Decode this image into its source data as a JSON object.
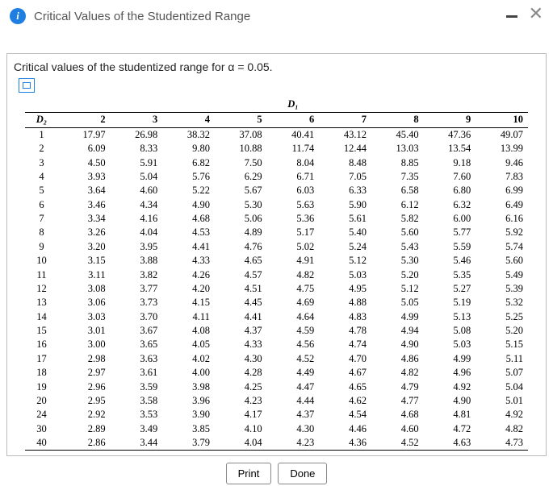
{
  "header": {
    "title": "Critical Values of the Studentized Range",
    "info_icon": "i"
  },
  "panel": {
    "caption": "Critical values of the studentized range for α = 0.05."
  },
  "chart_data": {
    "type": "table",
    "title": "Critical values of the studentized range for α = 0.05",
    "col_super_label": "D₁",
    "row_label": "D₂",
    "columns": [
      "2",
      "3",
      "4",
      "5",
      "6",
      "7",
      "8",
      "9",
      "10"
    ],
    "rows": [
      {
        "d2": "1",
        "v": [
          "17.97",
          "26.98",
          "38.32",
          "37.08",
          "40.41",
          "43.12",
          "45.40",
          "47.36",
          "49.07"
        ]
      },
      {
        "d2": "2",
        "v": [
          "6.09",
          "8.33",
          "9.80",
          "10.88",
          "11.74",
          "12.44",
          "13.03",
          "13.54",
          "13.99"
        ]
      },
      {
        "d2": "3",
        "v": [
          "4.50",
          "5.91",
          "6.82",
          "7.50",
          "8.04",
          "8.48",
          "8.85",
          "9.18",
          "9.46"
        ]
      },
      {
        "d2": "4",
        "v": [
          "3.93",
          "5.04",
          "5.76",
          "6.29",
          "6.71",
          "7.05",
          "7.35",
          "7.60",
          "7.83"
        ]
      },
      {
        "d2": "5",
        "v": [
          "3.64",
          "4.60",
          "5.22",
          "5.67",
          "6.03",
          "6.33",
          "6.58",
          "6.80",
          "6.99"
        ]
      },
      {
        "d2": "6",
        "v": [
          "3.46",
          "4.34",
          "4.90",
          "5.30",
          "5.63",
          "5.90",
          "6.12",
          "6.32",
          "6.49"
        ]
      },
      {
        "d2": "7",
        "v": [
          "3.34",
          "4.16",
          "4.68",
          "5.06",
          "5.36",
          "5.61",
          "5.82",
          "6.00",
          "6.16"
        ]
      },
      {
        "d2": "8",
        "v": [
          "3.26",
          "4.04",
          "4.53",
          "4.89",
          "5.17",
          "5.40",
          "5.60",
          "5.77",
          "5.92"
        ]
      },
      {
        "d2": "9",
        "v": [
          "3.20",
          "3.95",
          "4.41",
          "4.76",
          "5.02",
          "5.24",
          "5.43",
          "5.59",
          "5.74"
        ]
      },
      {
        "d2": "10",
        "v": [
          "3.15",
          "3.88",
          "4.33",
          "4.65",
          "4.91",
          "5.12",
          "5.30",
          "5.46",
          "5.60"
        ]
      },
      {
        "d2": "11",
        "v": [
          "3.11",
          "3.82",
          "4.26",
          "4.57",
          "4.82",
          "5.03",
          "5.20",
          "5.35",
          "5.49"
        ]
      },
      {
        "d2": "12",
        "v": [
          "3.08",
          "3.77",
          "4.20",
          "4.51",
          "4.75",
          "4.95",
          "5.12",
          "5.27",
          "5.39"
        ]
      },
      {
        "d2": "13",
        "v": [
          "3.06",
          "3.73",
          "4.15",
          "4.45",
          "4.69",
          "4.88",
          "5.05",
          "5.19",
          "5.32"
        ]
      },
      {
        "d2": "14",
        "v": [
          "3.03",
          "3.70",
          "4.11",
          "4.41",
          "4.64",
          "4.83",
          "4.99",
          "5.13",
          "5.25"
        ]
      },
      {
        "d2": "15",
        "v": [
          "3.01",
          "3.67",
          "4.08",
          "4.37",
          "4.59",
          "4.78",
          "4.94",
          "5.08",
          "5.20"
        ]
      },
      {
        "d2": "16",
        "v": [
          "3.00",
          "3.65",
          "4.05",
          "4.33",
          "4.56",
          "4.74",
          "4.90",
          "5.03",
          "5.15"
        ]
      },
      {
        "d2": "17",
        "v": [
          "2.98",
          "3.63",
          "4.02",
          "4.30",
          "4.52",
          "4.70",
          "4.86",
          "4.99",
          "5.11"
        ]
      },
      {
        "d2": "18",
        "v": [
          "2.97",
          "3.61",
          "4.00",
          "4.28",
          "4.49",
          "4.67",
          "4.82",
          "4.96",
          "5.07"
        ]
      },
      {
        "d2": "19",
        "v": [
          "2.96",
          "3.59",
          "3.98",
          "4.25",
          "4.47",
          "4.65",
          "4.79",
          "4.92",
          "5.04"
        ]
      },
      {
        "d2": "20",
        "v": [
          "2.95",
          "3.58",
          "3.96",
          "4.23",
          "4.44",
          "4.62",
          "4.77",
          "4.90",
          "5.01"
        ]
      },
      {
        "d2": "24",
        "v": [
          "2.92",
          "3.53",
          "3.90",
          "4.17",
          "4.37",
          "4.54",
          "4.68",
          "4.81",
          "4.92"
        ]
      },
      {
        "d2": "30",
        "v": [
          "2.89",
          "3.49",
          "3.85",
          "4.10",
          "4.30",
          "4.46",
          "4.60",
          "4.72",
          "4.82"
        ]
      },
      {
        "d2": "40",
        "v": [
          "2.86",
          "3.44",
          "3.79",
          "4.04",
          "4.23",
          "4.36",
          "4.52",
          "4.63",
          "4.73"
        ]
      }
    ]
  },
  "buttons": {
    "print": "Print",
    "done": "Done"
  }
}
